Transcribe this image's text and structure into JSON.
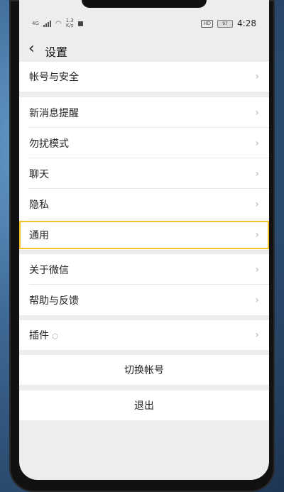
{
  "status_bar": {
    "network": "4G",
    "speed_top": "1.3",
    "speed_bottom": "K/s",
    "hd": "HD",
    "battery": "97",
    "time": "4:28"
  },
  "header": {
    "back_icon": "chevron-left-icon",
    "title": "设置"
  },
  "settings": {
    "account_security": "帐号与安全",
    "new_message": "新消息提醒",
    "do_not_disturb": "勿扰模式",
    "chat": "聊天",
    "privacy": "隐私",
    "general": "通用",
    "about": "关于微信",
    "help_feedback": "帮助与反馈",
    "plugins": "插件",
    "switch_account": "切换帐号",
    "logout": "退出"
  },
  "colors": {
    "highlight": "#f5c12b",
    "screen_bg": "#ededed",
    "row_bg": "#ffffff"
  }
}
